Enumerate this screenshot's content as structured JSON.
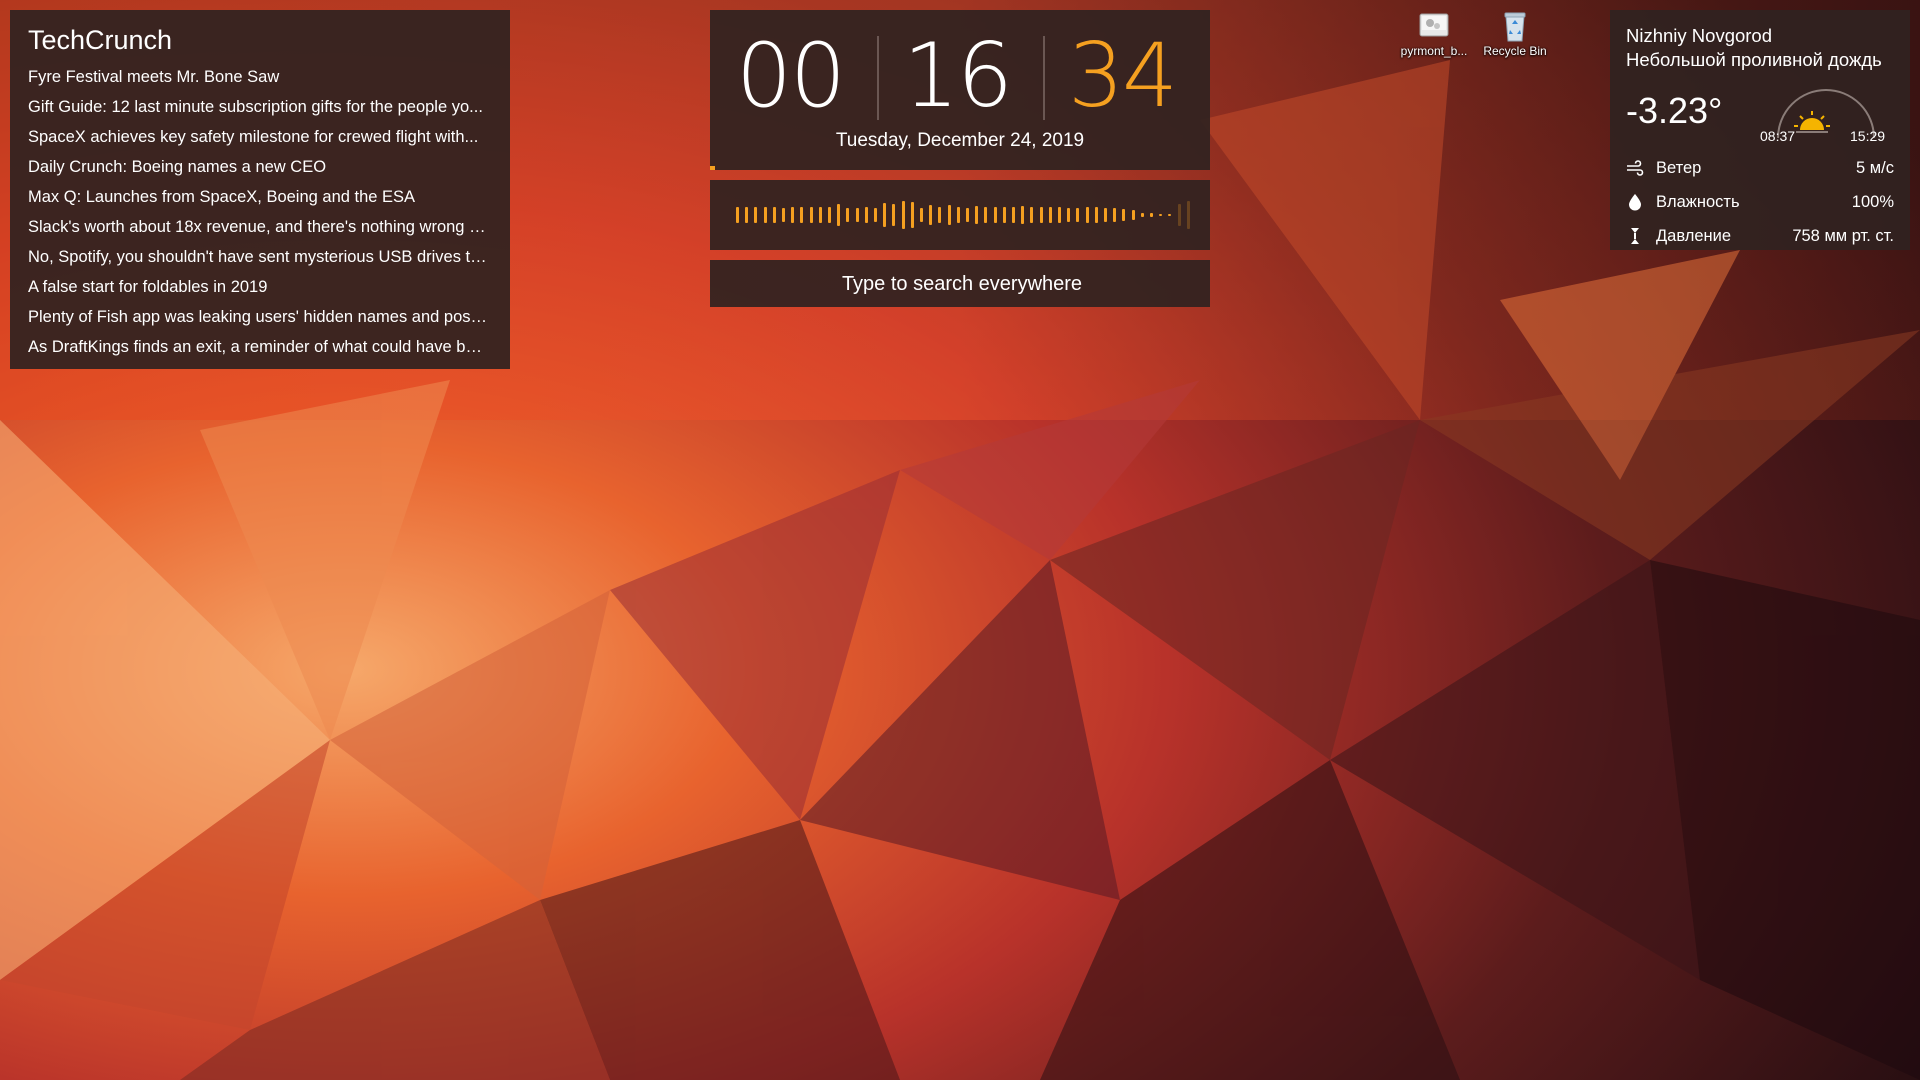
{
  "news": {
    "title": "TechCrunch",
    "items": [
      "Fyre Festival meets Mr. Bone Saw",
      "Gift Guide: 12 last minute subscription gifts for the people yo...",
      "SpaceX achieves key safety milestone for crewed flight with...",
      "Daily Crunch: Boeing names a new CEO",
      "Max Q: Launches from SpaceX, Boeing and the ESA",
      "Slack's worth about 18x revenue, and there's nothing wrong w...",
      "No, Spotify, you shouldn't have sent mysterious USB drives to...",
      "A false start for foldables in 2019",
      "Plenty of Fish app was leaking users' hidden names and post...",
      "As DraftKings finds an exit, a reminder of what could have be..."
    ]
  },
  "clock": {
    "hours": "00",
    "minutes": "16",
    "seconds": "34",
    "date": "Tuesday, December 24, 2019",
    "hours_color": "#ffffff",
    "minutes_color": "#ffffff",
    "seconds_color": "#f5a020",
    "seconds_progress": 0.01
  },
  "visualizer": {
    "bar_color": "#f5a020",
    "levels": [
      0.28,
      0.3,
      0.3,
      0.3,
      0.28,
      0.26,
      0.3,
      0.3,
      0.28,
      0.3,
      0.3,
      0.4,
      0.26,
      0.24,
      0.3,
      0.26,
      0.44,
      0.4,
      0.5,
      0.46,
      0.26,
      0.34,
      0.3,
      0.36,
      0.3,
      0.26,
      0.32,
      0.3,
      0.28,
      0.3,
      0.3,
      0.32,
      0.3,
      0.28,
      0.3,
      0.28,
      0.26,
      0.26,
      0.28,
      0.3,
      0.24,
      0.24,
      0.22,
      0.18,
      0.08,
      0.06,
      0.04,
      0.04,
      0.4,
      0.5
    ]
  },
  "search": {
    "placeholder": "Type to search everywhere"
  },
  "weather": {
    "city": "Nizhniy Novgorod",
    "description": "Небольшой проливной дождь",
    "temperature": "-3.23°",
    "sunrise": "08:37",
    "sunset": "15:29",
    "sun_color": "#f5b400",
    "rows": {
      "wind": {
        "icon": "wind-icon",
        "label": "Ветер",
        "value": "5 м/с"
      },
      "humidity": {
        "icon": "drop-icon",
        "label": "Влажность",
        "value": "100%"
      },
      "pressure": {
        "icon": "pressure-icon",
        "label": "Давление",
        "value": "758 мм рт. ст."
      }
    }
  },
  "desktop_icons": {
    "file": {
      "label": "pyrmont_b...",
      "icon": "file-icon"
    },
    "recycle": {
      "label": "Recycle Bin",
      "icon": "recycle-bin-icon"
    }
  }
}
